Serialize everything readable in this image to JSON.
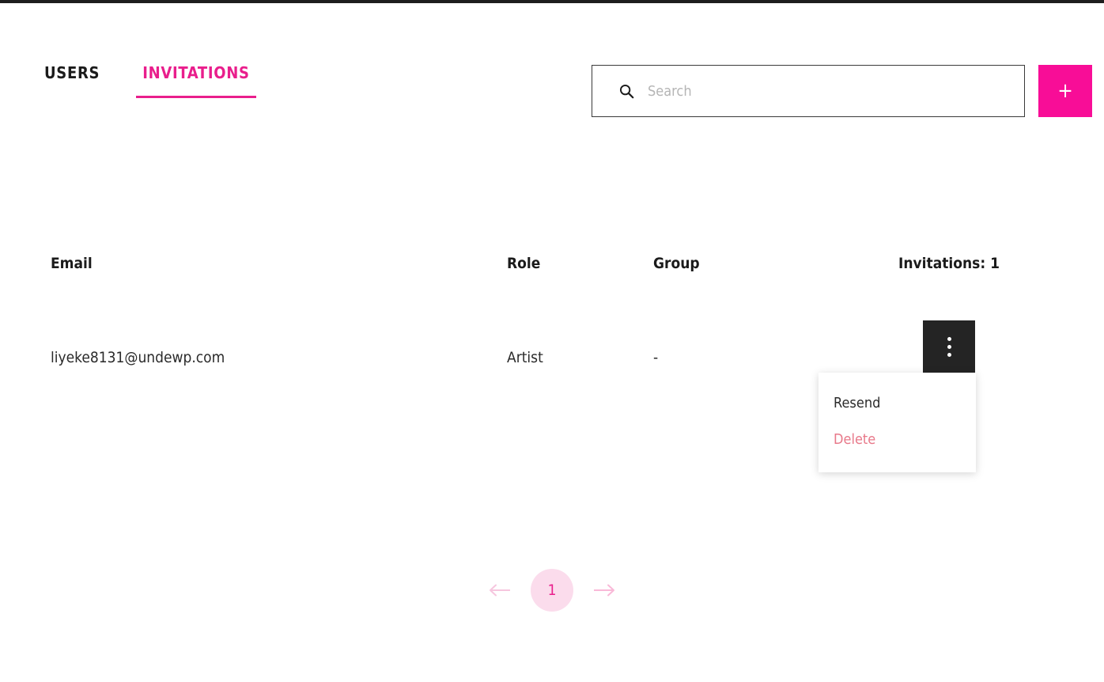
{
  "theme": {
    "accent": "#e91e8c",
    "accent_button": "#f80d97",
    "danger": "#e8798a",
    "dark": "#242424",
    "page_pill_bg": "#fbdcec",
    "arrow_pink": "#f7c3dd"
  },
  "tabs": [
    {
      "label": "USERS",
      "active": false,
      "name": "tab-users"
    },
    {
      "label": "INVITATIONS",
      "active": true,
      "name": "tab-invitations"
    }
  ],
  "search": {
    "placeholder": "Search",
    "value": "",
    "icon": "search-icon"
  },
  "add_button": {
    "label": "+",
    "icon": "plus-icon"
  },
  "table": {
    "columns": [
      {
        "key": "email",
        "label": "Email"
      },
      {
        "key": "role",
        "label": "Role"
      },
      {
        "key": "group",
        "label": "Group"
      },
      {
        "key": "count",
        "label": "Invitations: 1"
      }
    ],
    "rows": [
      {
        "email": "liyeke8131@undewp.com",
        "role": "Artist",
        "group": "-"
      }
    ]
  },
  "row_menu": {
    "trigger_icon": "kebab-menu-icon",
    "open": true,
    "items": [
      {
        "label": "Resend",
        "variant": "default"
      },
      {
        "label": "Delete",
        "variant": "danger"
      }
    ]
  },
  "pagination": {
    "prev_icon": "arrow-left-icon",
    "next_icon": "arrow-right-icon",
    "current_page": "1"
  }
}
